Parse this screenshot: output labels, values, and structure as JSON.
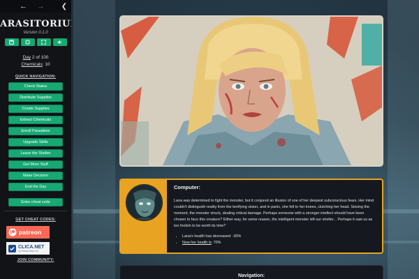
{
  "sidebar": {
    "title": "ARASITORIUM",
    "version": "Version 0.1.0",
    "day_label": "Day",
    "day_rest": " 2 of 100",
    "chemicals_label": "Chemicals",
    "chemicals_rest": ": 10",
    "quick_nav_heading": "QUICK NAVIGATION:",
    "nav_items": [
      "Check Status",
      "Distribute Supplies",
      "Create Supplies",
      "Extract Chemicals",
      "Enroll Parasitism",
      "Upgrade Skills",
      "Leave the Shelter",
      "Get More Stuff",
      "Make Decision",
      "End the Day"
    ],
    "cheat_button": "Enter cheat code",
    "cheat_heading": "GET CHEAT CODES:",
    "patreon_label": "patreon",
    "clica_label": "CLICA.NET",
    "clica_sub": "by Panda Mae Ltd",
    "join_heading": "JOIN COMMUNITY:"
  },
  "message": {
    "speaker": "Computer:",
    "body": "Lana was determined to fight the monster, but it conjured an illusion of one of her deepest subconscious fears. Her mind couldn't distinguish reality from the terrifying vision, and in panic, she fell to her knees, clutching her head. Seizing the moment, the monster struck, dealing critical damage. Perhaps someone with a stronger intellect should have been chosen to face this creature? Either way, for some reason, the intelligent monster left our shelter... Perhaps it saw us as too foolish to be worth its time?",
    "bullet1": "Lana's health has decreased: -30%",
    "bullet2_link": "Now her health is",
    "bullet2_rest": ": 70%"
  },
  "bottom_nav": {
    "label": "Navigation:"
  },
  "colors": {
    "accent_green": "#17a873",
    "accent_orange": "#e9a322",
    "patreon": "#f96854"
  },
  "icons": {
    "back": "arrow-left-icon",
    "forward": "arrow-right-icon",
    "collapse": "chevron-left-icon",
    "save": "save-icon",
    "restart": "restart-icon",
    "fullscreen": "fullscreen-icon",
    "audio": "speaker-icon"
  }
}
